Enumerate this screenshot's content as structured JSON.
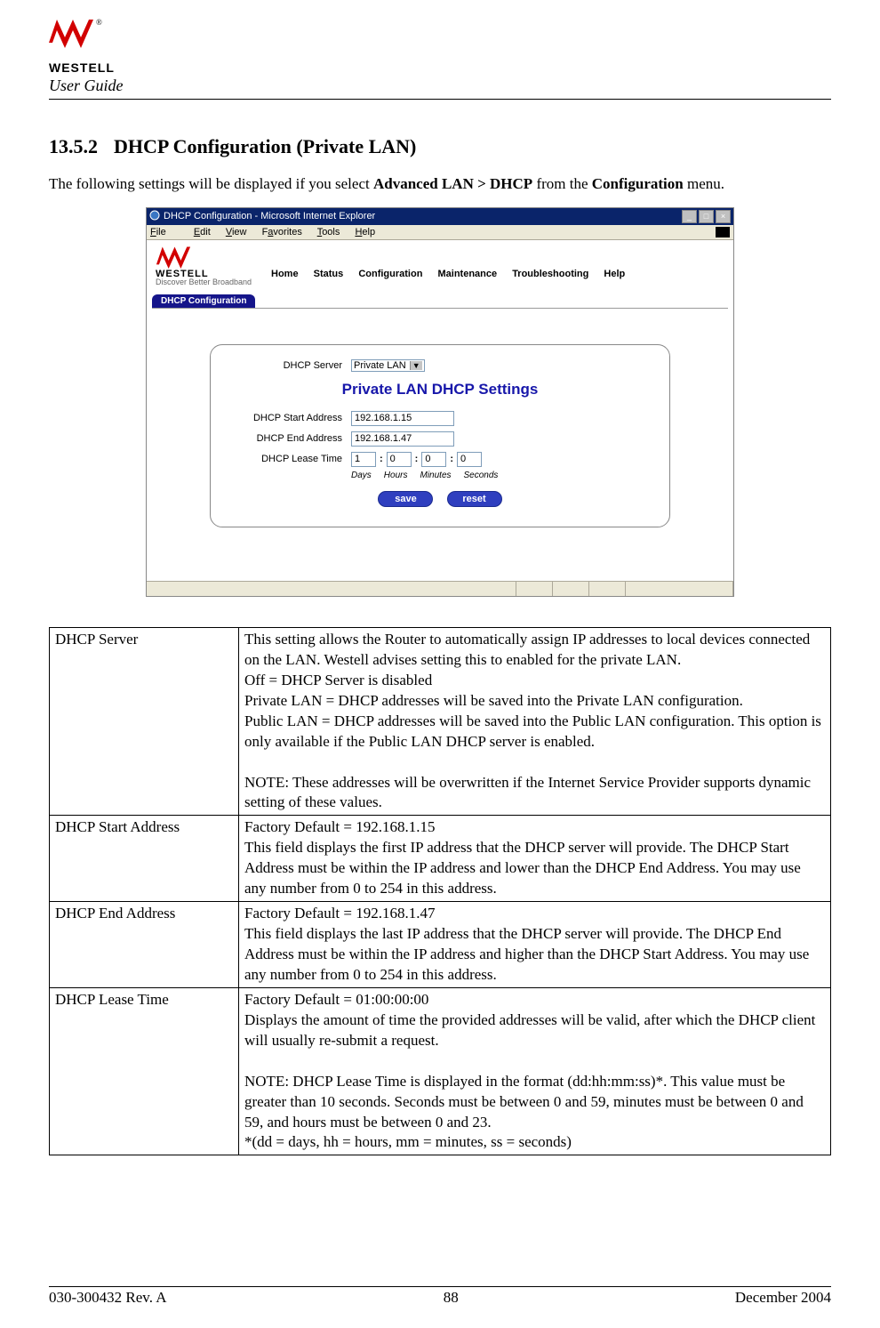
{
  "header": {
    "brand": "WESTELL",
    "guide": "User Guide"
  },
  "section": {
    "number": "13.5.2",
    "title": "DHCP Configuration (Private LAN)",
    "intro_pre": "The following settings will be displayed if you select ",
    "intro_bold1": "Advanced LAN > DHCP",
    "intro_mid": " from the ",
    "intro_bold2": "Configuration",
    "intro_post": " menu."
  },
  "screenshot": {
    "window_title": "DHCP Configuration - Microsoft Internet Explorer",
    "menu": {
      "file": "File",
      "edit": "Edit",
      "view": "View",
      "favorites": "Favorites",
      "tools": "Tools",
      "help": "Help"
    },
    "tagline": "Discover Better Broadband",
    "nav": {
      "home": "Home",
      "status": "Status",
      "configuration": "Configuration",
      "maintenance": "Maintenance",
      "troubleshooting": "Troubleshooting",
      "help": "Help"
    },
    "subtab": "DHCP Configuration",
    "form": {
      "server_label": "DHCP Server",
      "server_value": "Private LAN",
      "panel_heading": "Private LAN DHCP Settings",
      "start_label": "DHCP Start Address",
      "start_value": "192.168.1.15",
      "end_label": "DHCP End Address",
      "end_value": "192.168.1.47",
      "lease_label": "DHCP Lease Time",
      "days": "1",
      "hours": "0",
      "minutes": "0",
      "seconds": "0",
      "u_days": "Days",
      "u_hours": "Hours",
      "u_minutes": "Minutes",
      "u_seconds": "Seconds",
      "save": "save",
      "reset": "reset"
    }
  },
  "table": {
    "r1_term": "DHCP Server",
    "r1_desc": "This setting allows the Router to automatically assign IP addresses to local devices connected on the LAN. Westell advises setting this to enabled for the private LAN.\nOff = DHCP Server is disabled\nPrivate LAN = DHCP addresses will be saved into the Private LAN configuration.\nPublic LAN = DHCP addresses will be saved into the Public LAN configuration. This option is only available if the Public LAN DHCP server is enabled.\n\nNOTE: These addresses will be overwritten if the Internet Service Provider supports dynamic setting of these values.",
    "r2_term": "DHCP Start Address",
    "r2_desc": "Factory Default = 192.168.1.15\nThis field displays the first IP address that the DHCP server will provide. The DHCP Start Address must be within the IP address and lower than the DHCP End Address. You may use any number from 0 to 254 in this address.",
    "r3_term": "DHCP End Address",
    "r3_desc": "Factory Default = 192.168.1.47\nThis field displays the last IP address that the DHCP server will provide. The DHCP End Address must be within the IP address and higher than the DHCP Start Address. You may use any number from 0 to 254 in this address.",
    "r4_term": "DHCP Lease Time",
    "r4_desc": "Factory Default = 01:00:00:00\nDisplays the amount of time the provided addresses will be valid, after which the DHCP client will usually re-submit a request.\n\nNOTE: DHCP Lease Time is displayed in the format (dd:hh:mm:ss)*. This value must be greater than 10 seconds. Seconds must be between 0 and 59, minutes must be between 0 and 59, and hours must be between 0 and 23.\n*(dd = days, hh = hours, mm = minutes, ss = seconds)"
  },
  "footer": {
    "doc": "030-300432 Rev. A",
    "page": "88",
    "date": "December 2004"
  }
}
